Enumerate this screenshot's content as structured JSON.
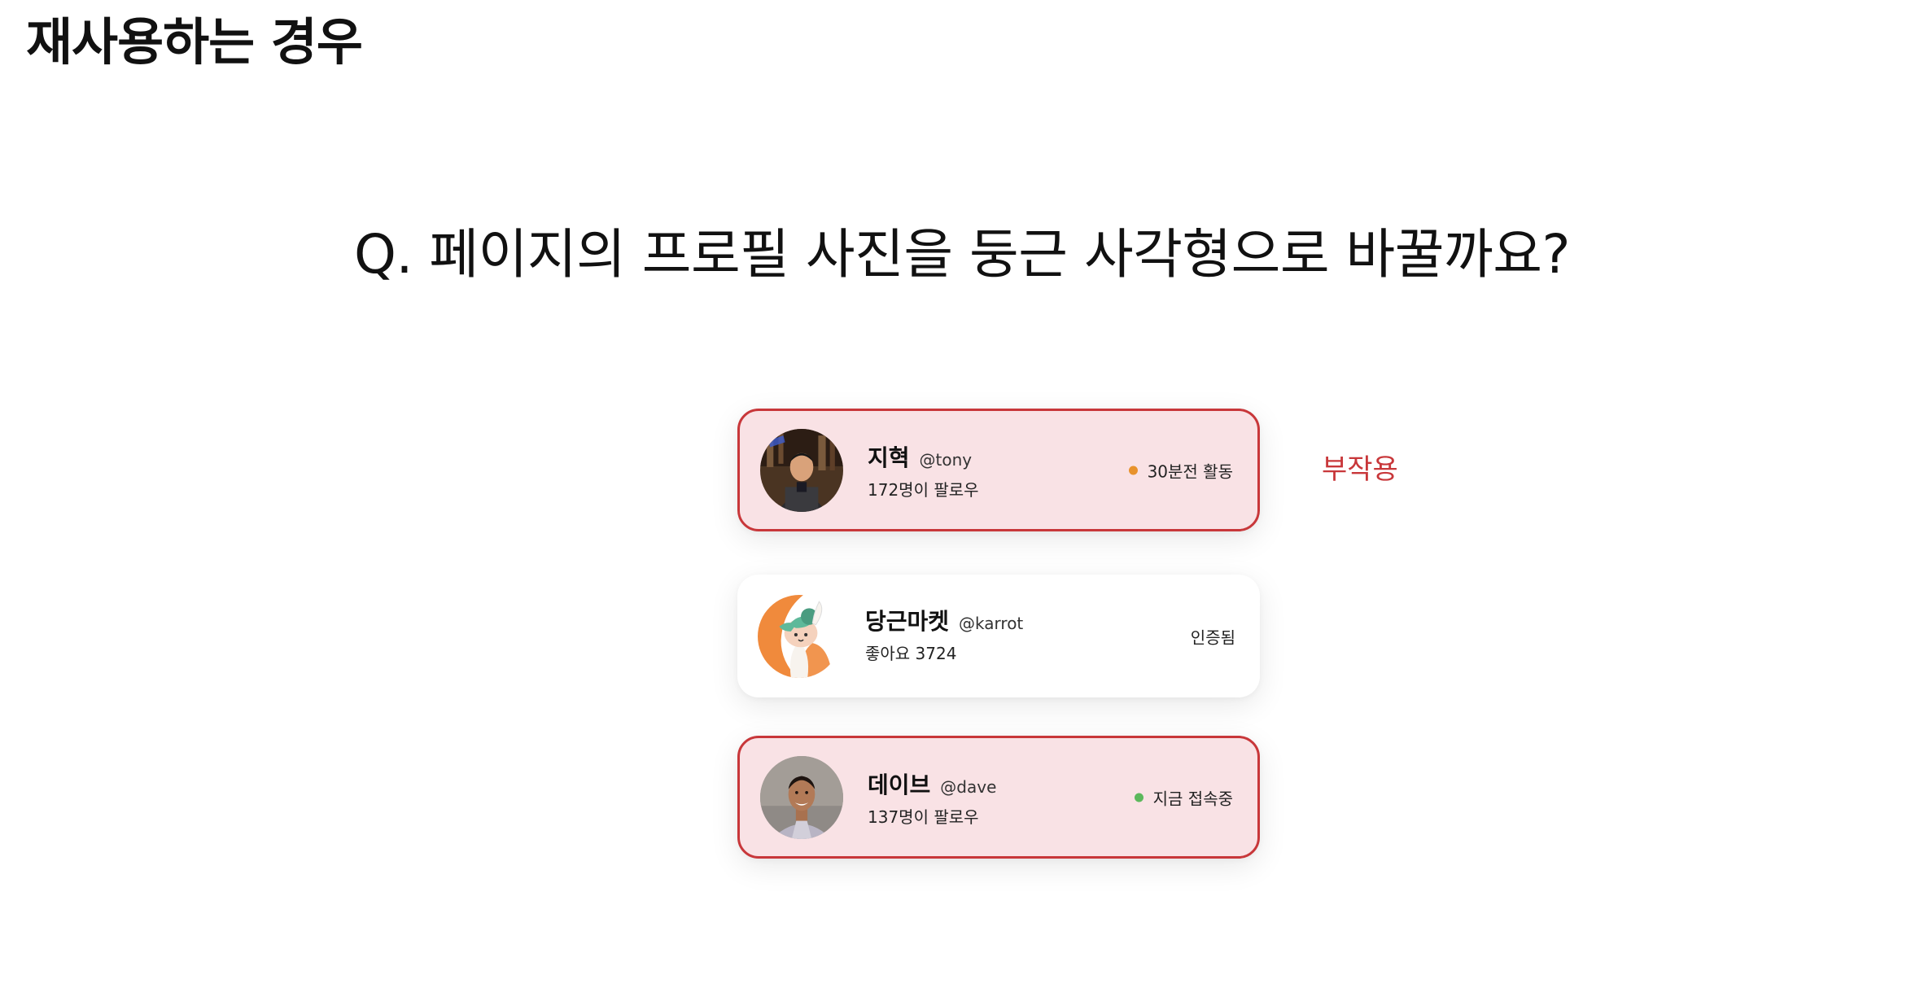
{
  "page": {
    "title": "재사용하는 경우",
    "question": "Q. 페이지의 프로필 사진을 둥근 사각형으로 바꿀까요?",
    "side_label": "부작용"
  },
  "cards": [
    {
      "name": "지혁",
      "handle": "@tony",
      "sub": "172명이 팔로우",
      "status": "30분전 활동",
      "status_color": "#e8922c",
      "highlighted": true,
      "avatar_icon": "person-photo-icon"
    },
    {
      "name": "당근마켓",
      "handle": "@karrot",
      "sub": "좋아요 3724",
      "status": "인증됨",
      "highlighted": false,
      "avatar_icon": "rabbit-mascot-icon"
    },
    {
      "name": "데이브",
      "handle": "@dave",
      "sub": "137명이 팔로우",
      "status": "지금 접속중",
      "status_color": "#5cb85c",
      "highlighted": true,
      "avatar_icon": "person-photo-icon"
    }
  ],
  "colors": {
    "highlight_border": "#c8373a",
    "highlight_bg": "#f9e2e5",
    "accent_red": "#c8373a"
  }
}
